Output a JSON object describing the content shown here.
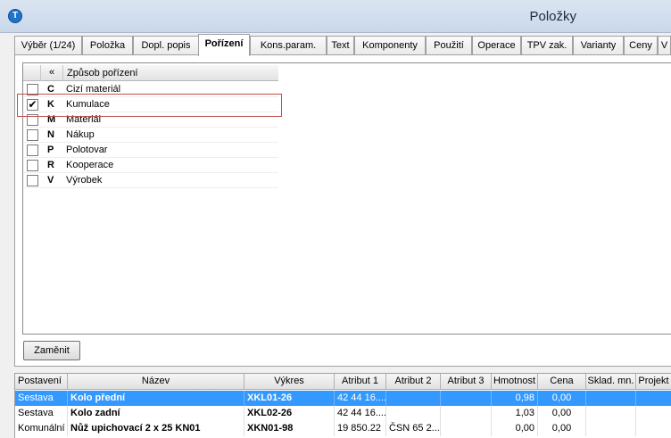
{
  "window": {
    "title": "Položky"
  },
  "tabs": [
    {
      "label": "Výběr (1/24)"
    },
    {
      "label": "Položka"
    },
    {
      "label": "Dopl. popis"
    },
    {
      "label": "Pořízení"
    },
    {
      "label": "Kons.param."
    },
    {
      "label": "Text"
    },
    {
      "label": "Komponenty"
    },
    {
      "label": "Použití"
    },
    {
      "label": "Operace"
    },
    {
      "label": "TPV zak."
    },
    {
      "label": "Varianty"
    },
    {
      "label": "Ceny"
    },
    {
      "label": "V"
    }
  ],
  "active_tab": "Pořízení",
  "method_list": {
    "header_collapse": "«",
    "header_name": "Způsob pořízení",
    "items": [
      {
        "code": "C",
        "name": "Cizí materiál",
        "checked": false,
        "mark": ""
      },
      {
        "code": "K",
        "name": "Kumulace",
        "checked": true,
        "mark": "✔"
      },
      {
        "code": "M",
        "name": "Materiál",
        "checked": false,
        "mark": ""
      },
      {
        "code": "N",
        "name": "Nákup",
        "checked": false,
        "mark": ""
      },
      {
        "code": "P",
        "name": "Polotovar",
        "checked": false,
        "mark": ""
      },
      {
        "code": "R",
        "name": "Kooperace",
        "checked": false,
        "mark": ""
      },
      {
        "code": "V",
        "name": "Výrobek",
        "checked": false,
        "mark": ""
      }
    ]
  },
  "replace_button": "Zaměnit",
  "grid": {
    "columns": [
      "Postavení",
      "Název",
      "Výkres",
      "Atribut 1",
      "Atribut 2",
      "Atribut 3",
      "Hmotnost",
      "Cena",
      "Sklad. mn.",
      "Projekt"
    ],
    "rows": [
      {
        "cells": [
          "Sestava",
          "Kolo přední",
          "XKL01-26",
          "42 44 16....",
          "",
          "",
          "0,98",
          "0,00",
          "",
          ""
        ],
        "selected": true
      },
      {
        "cells": [
          "Sestava",
          "Kolo zadní",
          "XKL02-26",
          "42 44 16....",
          "",
          "",
          "1,03",
          "0,00",
          "",
          ""
        ],
        "selected": false
      },
      {
        "cells": [
          "Komunální na",
          "Nůž upichovací 2 x 25 KN01",
          "XKN01-98",
          "19 850.22",
          "ČSN 65 2...",
          "",
          "0,00",
          "0,00",
          "",
          ""
        ],
        "selected": false
      }
    ]
  },
  "colors": {
    "selection": "#3399ff",
    "highlight_box": "#c0504d"
  }
}
